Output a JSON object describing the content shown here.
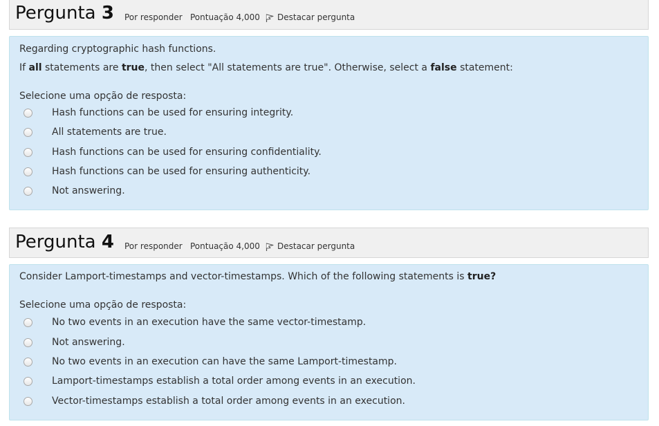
{
  "questions": [
    {
      "title_word": "Pergunta",
      "number": "3",
      "state": "Por responder",
      "grade": "Pontuação 4,000",
      "flag_label": "Destacar pergunta",
      "text_line1": "Regarding cryptographic hash functions.",
      "text_line2": {
        "p1": "If ",
        "b1": "all",
        "p2": " statements are ",
        "b2": "true",
        "p3": ", then select \"All statements are true\". Otherwise, select a ",
        "b3": "false",
        "p4": " statement:"
      },
      "prompt": "Selecione uma opção de resposta:",
      "options": [
        "Hash functions can be used for ensuring integrity.",
        "All statements are true.",
        "Hash functions can be used for ensuring confidentiality.",
        "Hash functions can be used for ensuring authenticity.",
        "Not answering."
      ]
    },
    {
      "title_word": "Pergunta",
      "number": "4",
      "state": "Por responder",
      "grade": "Pontuação 4,000",
      "flag_label": "Destacar pergunta",
      "text_line1": {
        "p1": "Consider Lamport-timestamps and vector-timestamps. Which of the following statements is ",
        "b1": "true?"
      },
      "prompt": "Selecione uma opção de resposta:",
      "options": [
        "No two events in an execution have the same vector-timestamp.",
        "Not answering.",
        "No two events in an execution can have the same Lamport-timestamp.",
        "Lamport-timestamps establish a total order among events in an execution.",
        "Vector-timestamps establish a total order among events in an execution."
      ]
    }
  ]
}
